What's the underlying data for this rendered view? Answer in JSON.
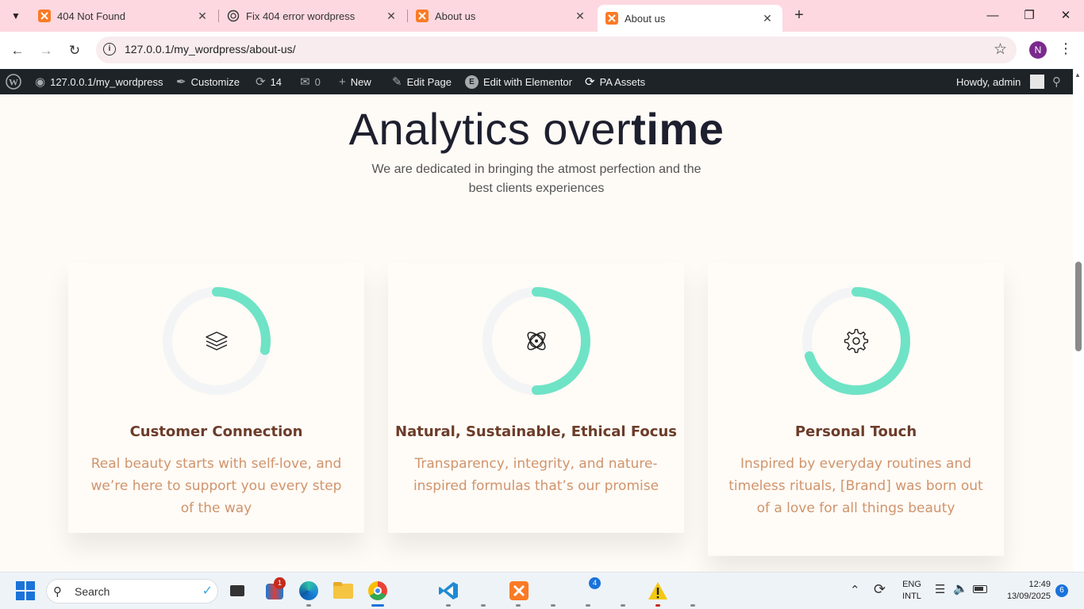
{
  "browser": {
    "tabs": [
      {
        "title": "404 Not Found",
        "favicon": "xampp-icon"
      },
      {
        "title": "Fix 404 error wordpress",
        "favicon": "chatgpt-icon"
      },
      {
        "title": "About us",
        "favicon": "xampp-icon"
      },
      {
        "title": "About us",
        "favicon": "xampp-icon",
        "active": true
      }
    ],
    "url": "127.0.0.1/my_wordpress/about-us/",
    "profile_initial": "N"
  },
  "adminbar": {
    "site": "127.0.0.1/my_wordpress",
    "customize": "Customize",
    "updates_count": "14",
    "comments_count": "0",
    "new": "New",
    "edit_page": "Edit Page",
    "edit_elementor": "Edit with Elementor",
    "pa_assets": "PA Assets",
    "howdy": "Howdy, admin"
  },
  "content": {
    "heading_light": "Analytics over",
    "heading_bold": "time",
    "subtitle": "We are dedicated in bringing the atmost perfection and the best clients experiences",
    "cards": [
      {
        "title": "Customer Connection",
        "text": "Real beauty starts with self-love, and we’re here to support you every step of the way",
        "icon": "layers-icon",
        "progress": 0.28
      },
      {
        "title": "Natural, Sustainable, Ethical Focus",
        "text": "Transparency, integrity, and nature-inspired formulas that’s our promise",
        "icon": "atom-icon",
        "progress": 0.5
      },
      {
        "title": "Personal Touch",
        "text": "Inspired by everyday routines and timeless rituals, [Brand] was born out of a love for all things beauty",
        "icon": "gear-icon",
        "progress": 0.7
      }
    ],
    "accent": "#6fe3c6",
    "track": "#f3f4f6"
  },
  "taskbar": {
    "search_label": "Search",
    "store_badge": "1",
    "chrome_badge": "4",
    "lang_top": "ENG",
    "lang_bottom": "INTL",
    "time": "12:49",
    "date": "13/09/2025",
    "notif_count": "6"
  }
}
